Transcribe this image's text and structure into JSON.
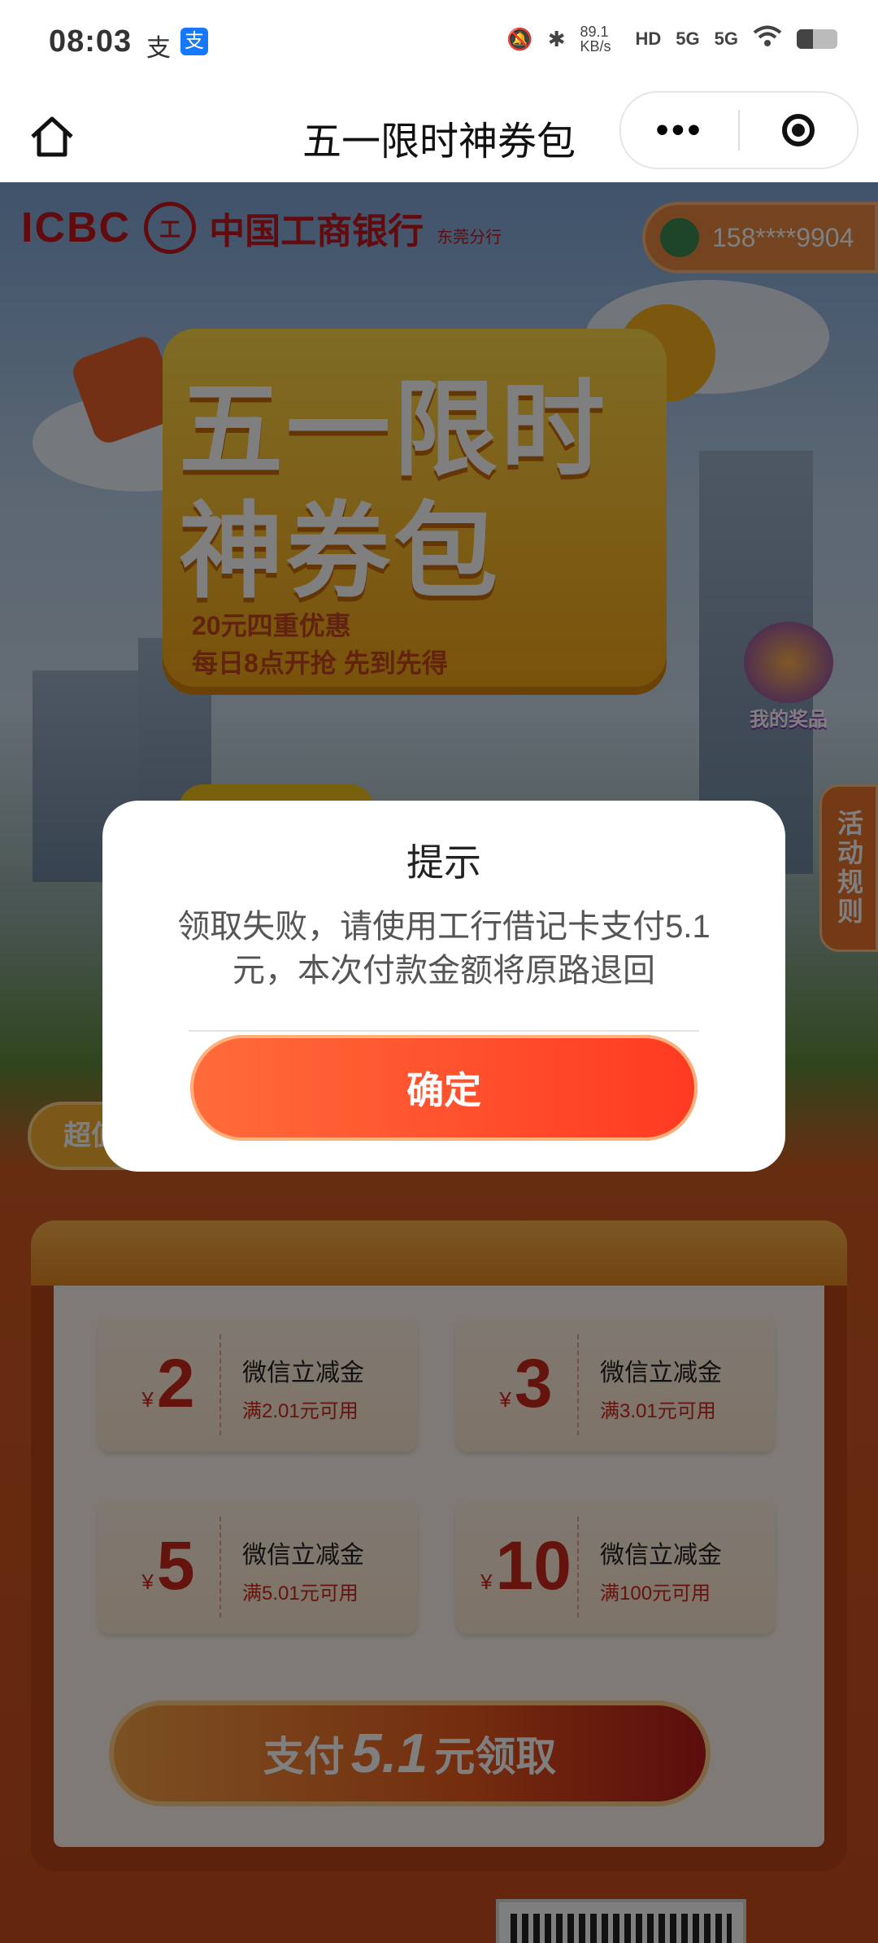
{
  "status_bar": {
    "time": "08:03",
    "icons": [
      "alipay-icon",
      "alipay-app-icon",
      "mute-icon",
      "bluetooth-icon",
      "hd-icon",
      "signal-5g-icon",
      "signal-5g-icon",
      "wifi-icon",
      "battery-icon"
    ],
    "speed": "89.1 KB/s",
    "hd": "HD",
    "net1": "5G",
    "net2": "5G"
  },
  "nav": {
    "title": "五一限时神券包",
    "more_label": "•••"
  },
  "bank": {
    "logo_text": "ICBC",
    "logo_mark": "工",
    "name": "中国工商银行",
    "branch": "东莞分行",
    "phone": "158****9904"
  },
  "hero": {
    "title_line1": "五一限时",
    "title_line2": "神券包",
    "subtitle1": "20元四重优惠",
    "subtitle2": "每日8点开抢 先到先得"
  },
  "side": {
    "prize_label": "我的奖品",
    "rules_label": "活动规则"
  },
  "badge": {
    "label": "超值"
  },
  "coupons": [
    {
      "currency": "¥",
      "amount": "2",
      "name": "微信立减金",
      "condition": "满2.01元可用"
    },
    {
      "currency": "¥",
      "amount": "3",
      "name": "微信立减金",
      "condition": "满3.01元可用"
    },
    {
      "currency": "¥",
      "amount": "5",
      "name": "微信立减金",
      "condition": "满5.01元可用"
    },
    {
      "currency": "¥",
      "amount": "10",
      "name": "微信立减金",
      "condition": "满100元可用"
    }
  ],
  "pay": {
    "prefix": "支付",
    "amount": "5.1",
    "suffix": "元领取"
  },
  "dialog": {
    "title": "提示",
    "message": "领取失败，请使用工行借记卡支付5.1元，本次付款金额将原路退回",
    "confirm": "确定"
  },
  "colors": {
    "brand_red": "#c4161c",
    "accent_orange": "#e8752c",
    "confirm_button": "#ff4a2a"
  }
}
